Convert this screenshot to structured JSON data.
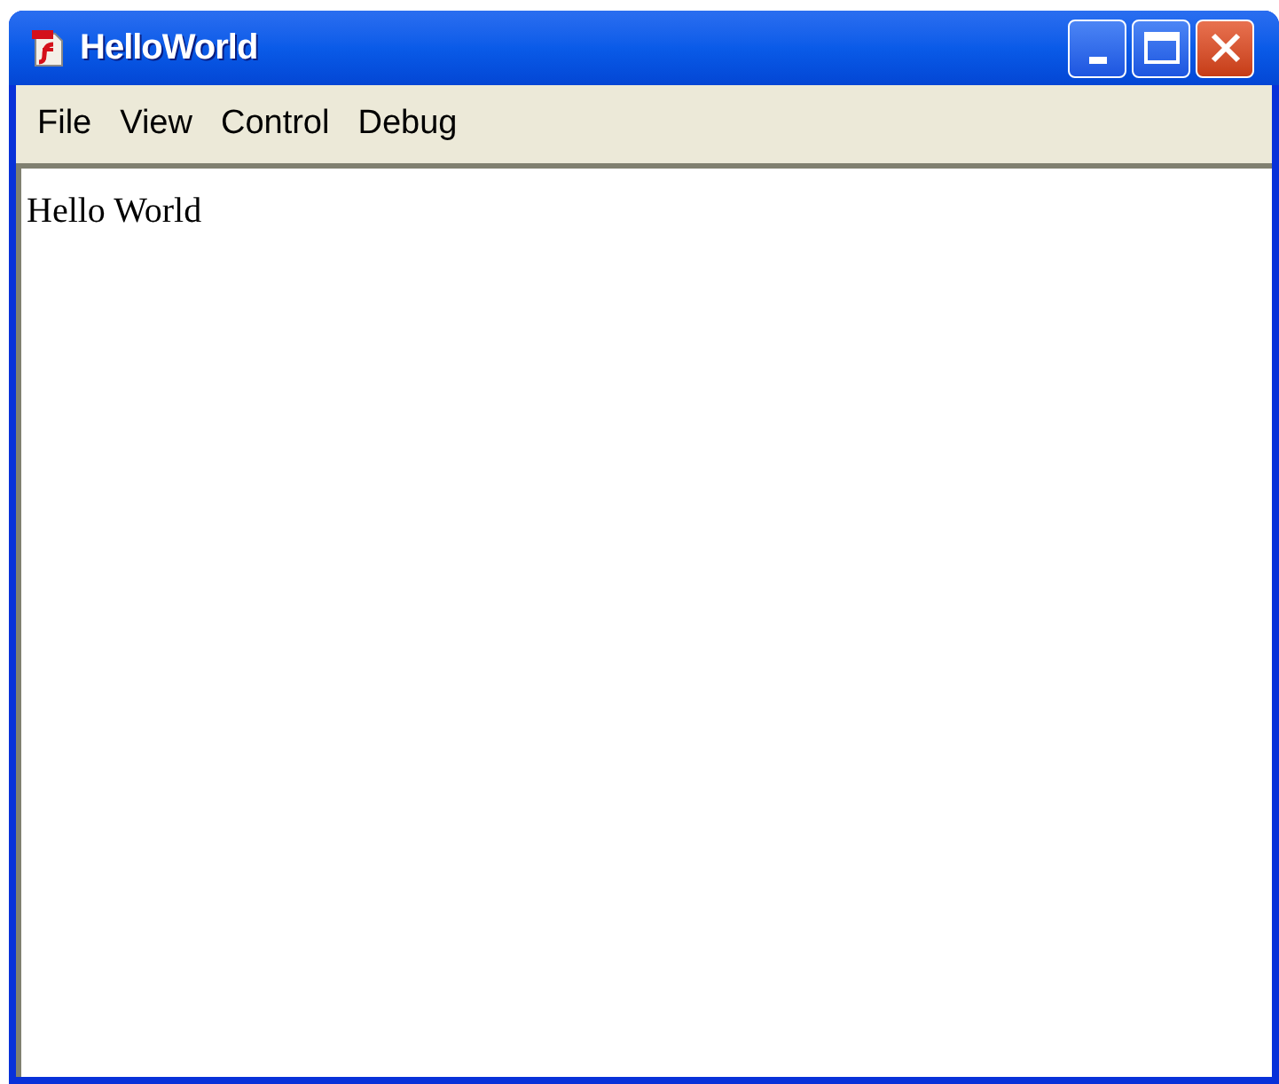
{
  "window": {
    "title": "HelloWorld"
  },
  "menu": [
    {
      "label": "File"
    },
    {
      "label": "View"
    },
    {
      "label": "Control"
    },
    {
      "label": "Debug"
    }
  ],
  "content": {
    "text": "Hello World"
  }
}
